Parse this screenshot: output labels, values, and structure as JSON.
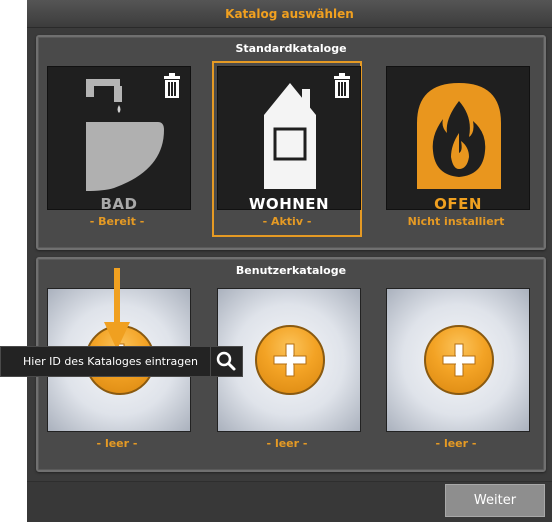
{
  "window": {
    "title": "Katalog auswählen"
  },
  "standard": {
    "title": "Standardkataloge",
    "tiles": [
      {
        "caption": "BAD",
        "status": "- Bereit -",
        "icon": "bath-icon"
      },
      {
        "caption": "WOHNEN",
        "status": "- Aktiv -",
        "icon": "house-icon"
      },
      {
        "caption": "OFEN",
        "status": "Nicht installiert",
        "icon": "flame-icon"
      }
    ]
  },
  "user": {
    "title": "Benutzerkataloge",
    "tiles": [
      {
        "status": "- leer -"
      },
      {
        "status": "- leer -"
      },
      {
        "status": "- leer -"
      }
    ]
  },
  "search": {
    "placeholder": "Hier ID des Kataloges eintragen"
  },
  "footer": {
    "next_label": "Weiter"
  },
  "colors": {
    "accent": "#e59a24",
    "background": "#3b3b3b"
  }
}
